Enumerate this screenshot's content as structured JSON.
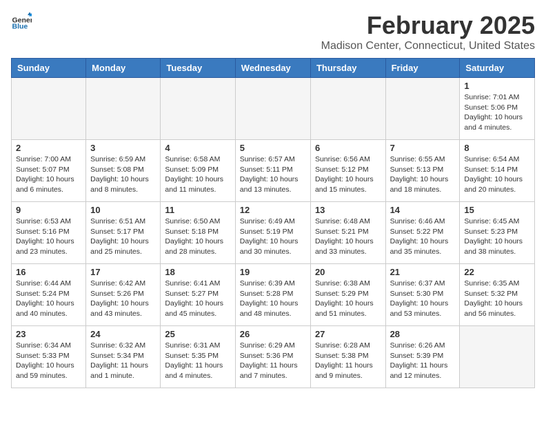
{
  "header": {
    "logo_general": "General",
    "logo_blue": "Blue",
    "month_title": "February 2025",
    "location": "Madison Center, Connecticut, United States"
  },
  "weekdays": [
    "Sunday",
    "Monday",
    "Tuesday",
    "Wednesday",
    "Thursday",
    "Friday",
    "Saturday"
  ],
  "weeks": [
    [
      {
        "day": "",
        "info": ""
      },
      {
        "day": "",
        "info": ""
      },
      {
        "day": "",
        "info": ""
      },
      {
        "day": "",
        "info": ""
      },
      {
        "day": "",
        "info": ""
      },
      {
        "day": "",
        "info": ""
      },
      {
        "day": "1",
        "info": "Sunrise: 7:01 AM\nSunset: 5:06 PM\nDaylight: 10 hours and 4 minutes."
      }
    ],
    [
      {
        "day": "2",
        "info": "Sunrise: 7:00 AM\nSunset: 5:07 PM\nDaylight: 10 hours and 6 minutes."
      },
      {
        "day": "3",
        "info": "Sunrise: 6:59 AM\nSunset: 5:08 PM\nDaylight: 10 hours and 8 minutes."
      },
      {
        "day": "4",
        "info": "Sunrise: 6:58 AM\nSunset: 5:09 PM\nDaylight: 10 hours and 11 minutes."
      },
      {
        "day": "5",
        "info": "Sunrise: 6:57 AM\nSunset: 5:11 PM\nDaylight: 10 hours and 13 minutes."
      },
      {
        "day": "6",
        "info": "Sunrise: 6:56 AM\nSunset: 5:12 PM\nDaylight: 10 hours and 15 minutes."
      },
      {
        "day": "7",
        "info": "Sunrise: 6:55 AM\nSunset: 5:13 PM\nDaylight: 10 hours and 18 minutes."
      },
      {
        "day": "8",
        "info": "Sunrise: 6:54 AM\nSunset: 5:14 PM\nDaylight: 10 hours and 20 minutes."
      }
    ],
    [
      {
        "day": "9",
        "info": "Sunrise: 6:53 AM\nSunset: 5:16 PM\nDaylight: 10 hours and 23 minutes."
      },
      {
        "day": "10",
        "info": "Sunrise: 6:51 AM\nSunset: 5:17 PM\nDaylight: 10 hours and 25 minutes."
      },
      {
        "day": "11",
        "info": "Sunrise: 6:50 AM\nSunset: 5:18 PM\nDaylight: 10 hours and 28 minutes."
      },
      {
        "day": "12",
        "info": "Sunrise: 6:49 AM\nSunset: 5:19 PM\nDaylight: 10 hours and 30 minutes."
      },
      {
        "day": "13",
        "info": "Sunrise: 6:48 AM\nSunset: 5:21 PM\nDaylight: 10 hours and 33 minutes."
      },
      {
        "day": "14",
        "info": "Sunrise: 6:46 AM\nSunset: 5:22 PM\nDaylight: 10 hours and 35 minutes."
      },
      {
        "day": "15",
        "info": "Sunrise: 6:45 AM\nSunset: 5:23 PM\nDaylight: 10 hours and 38 minutes."
      }
    ],
    [
      {
        "day": "16",
        "info": "Sunrise: 6:44 AM\nSunset: 5:24 PM\nDaylight: 10 hours and 40 minutes."
      },
      {
        "day": "17",
        "info": "Sunrise: 6:42 AM\nSunset: 5:26 PM\nDaylight: 10 hours and 43 minutes."
      },
      {
        "day": "18",
        "info": "Sunrise: 6:41 AM\nSunset: 5:27 PM\nDaylight: 10 hours and 45 minutes."
      },
      {
        "day": "19",
        "info": "Sunrise: 6:39 AM\nSunset: 5:28 PM\nDaylight: 10 hours and 48 minutes."
      },
      {
        "day": "20",
        "info": "Sunrise: 6:38 AM\nSunset: 5:29 PM\nDaylight: 10 hours and 51 minutes."
      },
      {
        "day": "21",
        "info": "Sunrise: 6:37 AM\nSunset: 5:30 PM\nDaylight: 10 hours and 53 minutes."
      },
      {
        "day": "22",
        "info": "Sunrise: 6:35 AM\nSunset: 5:32 PM\nDaylight: 10 hours and 56 minutes."
      }
    ],
    [
      {
        "day": "23",
        "info": "Sunrise: 6:34 AM\nSunset: 5:33 PM\nDaylight: 10 hours and 59 minutes."
      },
      {
        "day": "24",
        "info": "Sunrise: 6:32 AM\nSunset: 5:34 PM\nDaylight: 11 hours and 1 minute."
      },
      {
        "day": "25",
        "info": "Sunrise: 6:31 AM\nSunset: 5:35 PM\nDaylight: 11 hours and 4 minutes."
      },
      {
        "day": "26",
        "info": "Sunrise: 6:29 AM\nSunset: 5:36 PM\nDaylight: 11 hours and 7 minutes."
      },
      {
        "day": "27",
        "info": "Sunrise: 6:28 AM\nSunset: 5:38 PM\nDaylight: 11 hours and 9 minutes."
      },
      {
        "day": "28",
        "info": "Sunrise: 6:26 AM\nSunset: 5:39 PM\nDaylight: 11 hours and 12 minutes."
      },
      {
        "day": "",
        "info": ""
      }
    ]
  ]
}
